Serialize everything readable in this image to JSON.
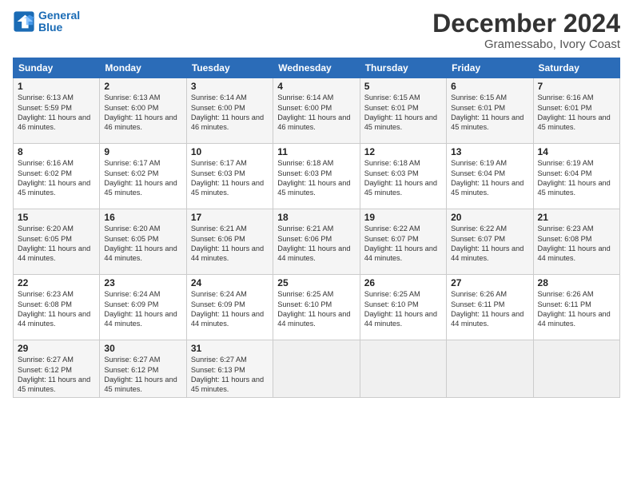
{
  "logo": {
    "line1": "General",
    "line2": "Blue"
  },
  "title": "December 2024",
  "location": "Gramessabo, Ivory Coast",
  "days_header": [
    "Sunday",
    "Monday",
    "Tuesday",
    "Wednesday",
    "Thursday",
    "Friday",
    "Saturday"
  ],
  "weeks": [
    [
      {
        "day": "1",
        "sunrise": "6:13 AM",
        "sunset": "5:59 PM",
        "daylight": "11 hours and 46 minutes."
      },
      {
        "day": "2",
        "sunrise": "6:13 AM",
        "sunset": "6:00 PM",
        "daylight": "11 hours and 46 minutes."
      },
      {
        "day": "3",
        "sunrise": "6:14 AM",
        "sunset": "6:00 PM",
        "daylight": "11 hours and 46 minutes."
      },
      {
        "day": "4",
        "sunrise": "6:14 AM",
        "sunset": "6:00 PM",
        "daylight": "11 hours and 46 minutes."
      },
      {
        "day": "5",
        "sunrise": "6:15 AM",
        "sunset": "6:01 PM",
        "daylight": "11 hours and 45 minutes."
      },
      {
        "day": "6",
        "sunrise": "6:15 AM",
        "sunset": "6:01 PM",
        "daylight": "11 hours and 45 minutes."
      },
      {
        "day": "7",
        "sunrise": "6:16 AM",
        "sunset": "6:01 PM",
        "daylight": "11 hours and 45 minutes."
      }
    ],
    [
      {
        "day": "8",
        "sunrise": "6:16 AM",
        "sunset": "6:02 PM",
        "daylight": "11 hours and 45 minutes."
      },
      {
        "day": "9",
        "sunrise": "6:17 AM",
        "sunset": "6:02 PM",
        "daylight": "11 hours and 45 minutes."
      },
      {
        "day": "10",
        "sunrise": "6:17 AM",
        "sunset": "6:03 PM",
        "daylight": "11 hours and 45 minutes."
      },
      {
        "day": "11",
        "sunrise": "6:18 AM",
        "sunset": "6:03 PM",
        "daylight": "11 hours and 45 minutes."
      },
      {
        "day": "12",
        "sunrise": "6:18 AM",
        "sunset": "6:03 PM",
        "daylight": "11 hours and 45 minutes."
      },
      {
        "day": "13",
        "sunrise": "6:19 AM",
        "sunset": "6:04 PM",
        "daylight": "11 hours and 45 minutes."
      },
      {
        "day": "14",
        "sunrise": "6:19 AM",
        "sunset": "6:04 PM",
        "daylight": "11 hours and 45 minutes."
      }
    ],
    [
      {
        "day": "15",
        "sunrise": "6:20 AM",
        "sunset": "6:05 PM",
        "daylight": "11 hours and 44 minutes."
      },
      {
        "day": "16",
        "sunrise": "6:20 AM",
        "sunset": "6:05 PM",
        "daylight": "11 hours and 44 minutes."
      },
      {
        "day": "17",
        "sunrise": "6:21 AM",
        "sunset": "6:06 PM",
        "daylight": "11 hours and 44 minutes."
      },
      {
        "day": "18",
        "sunrise": "6:21 AM",
        "sunset": "6:06 PM",
        "daylight": "11 hours and 44 minutes."
      },
      {
        "day": "19",
        "sunrise": "6:22 AM",
        "sunset": "6:07 PM",
        "daylight": "11 hours and 44 minutes."
      },
      {
        "day": "20",
        "sunrise": "6:22 AM",
        "sunset": "6:07 PM",
        "daylight": "11 hours and 44 minutes."
      },
      {
        "day": "21",
        "sunrise": "6:23 AM",
        "sunset": "6:08 PM",
        "daylight": "11 hours and 44 minutes."
      }
    ],
    [
      {
        "day": "22",
        "sunrise": "6:23 AM",
        "sunset": "6:08 PM",
        "daylight": "11 hours and 44 minutes."
      },
      {
        "day": "23",
        "sunrise": "6:24 AM",
        "sunset": "6:09 PM",
        "daylight": "11 hours and 44 minutes."
      },
      {
        "day": "24",
        "sunrise": "6:24 AM",
        "sunset": "6:09 PM",
        "daylight": "11 hours and 44 minutes."
      },
      {
        "day": "25",
        "sunrise": "6:25 AM",
        "sunset": "6:10 PM",
        "daylight": "11 hours and 44 minutes."
      },
      {
        "day": "26",
        "sunrise": "6:25 AM",
        "sunset": "6:10 PM",
        "daylight": "11 hours and 44 minutes."
      },
      {
        "day": "27",
        "sunrise": "6:26 AM",
        "sunset": "6:11 PM",
        "daylight": "11 hours and 44 minutes."
      },
      {
        "day": "28",
        "sunrise": "6:26 AM",
        "sunset": "6:11 PM",
        "daylight": "11 hours and 44 minutes."
      }
    ],
    [
      {
        "day": "29",
        "sunrise": "6:27 AM",
        "sunset": "6:12 PM",
        "daylight": "11 hours and 45 minutes."
      },
      {
        "day": "30",
        "sunrise": "6:27 AM",
        "sunset": "6:12 PM",
        "daylight": "11 hours and 45 minutes."
      },
      {
        "day": "31",
        "sunrise": "6:27 AM",
        "sunset": "6:13 PM",
        "daylight": "11 hours and 45 minutes."
      },
      null,
      null,
      null,
      null
    ]
  ]
}
